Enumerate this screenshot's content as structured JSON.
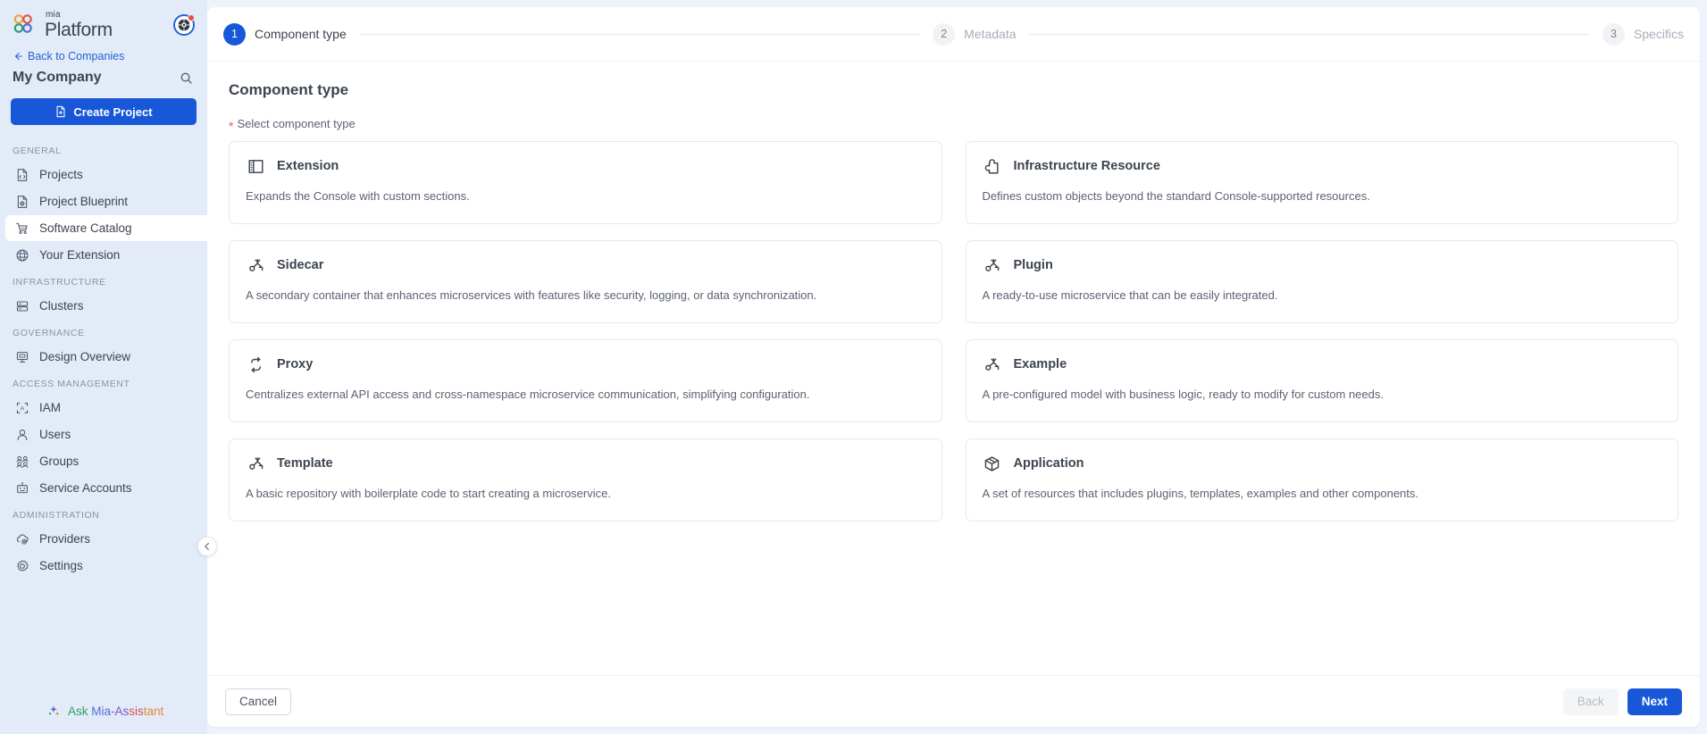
{
  "sidebar": {
    "brand": {
      "small": "mia",
      "name": "Platform",
      "logo_icon": "mia-logo-icon"
    },
    "avatar": {
      "icon": "user-avatar-icon",
      "notification_dot": true
    },
    "back_link": {
      "label": "Back to Companies",
      "icon": "arrow-left-icon"
    },
    "company": {
      "name": "My Company",
      "search_icon": "search-icon"
    },
    "create_button": {
      "label": "Create Project",
      "icon": "file-plus-icon"
    },
    "sections": [
      {
        "title": "GENERAL",
        "items": [
          {
            "label": "Projects",
            "icon": "projects-file-icon",
            "active": false
          },
          {
            "label": "Project Blueprint",
            "icon": "blueprint-icon",
            "active": false
          },
          {
            "label": "Software Catalog",
            "icon": "catalog-cart-icon",
            "active": true
          },
          {
            "label": "Your Extension",
            "icon": "globe-icon",
            "active": false
          }
        ]
      },
      {
        "title": "INFRASTRUCTURE",
        "items": [
          {
            "label": "Clusters",
            "icon": "clusters-icon",
            "active": false
          }
        ]
      },
      {
        "title": "GOVERNANCE",
        "items": [
          {
            "label": "Design Overview",
            "icon": "design-board-icon",
            "active": false
          }
        ]
      },
      {
        "title": "ACCESS MANAGEMENT",
        "items": [
          {
            "label": "IAM",
            "icon": "iam-scan-icon",
            "active": false
          },
          {
            "label": "Users",
            "icon": "user-icon",
            "active": false
          },
          {
            "label": "Groups",
            "icon": "groups-icon",
            "active": false
          },
          {
            "label": "Service Accounts",
            "icon": "robot-icon",
            "active": false
          }
        ]
      },
      {
        "title": "ADMINISTRATION",
        "items": [
          {
            "label": "Providers",
            "icon": "cloud-gear-icon",
            "active": false
          },
          {
            "label": "Settings",
            "icon": "gear-icon",
            "active": false
          }
        ]
      }
    ],
    "assistant": {
      "icon": "sparkle-icon",
      "parts": [
        "Ask",
        " Mia",
        "-As",
        "sis",
        "tant"
      ]
    },
    "collapse_button": {
      "icon": "chevron-left-icon"
    }
  },
  "stepper": {
    "steps": [
      {
        "num": "1",
        "label": "Component type",
        "state": "active"
      },
      {
        "num": "2",
        "label": "Metadata",
        "state": "inactive"
      },
      {
        "num": "3",
        "label": "Specifics",
        "state": "inactive"
      }
    ]
  },
  "main": {
    "title": "Component type",
    "field_label": "Select component type",
    "required_marker": "*",
    "cards": [
      {
        "title": "Extension",
        "desc": "Expands the Console with custom sections.",
        "icon": "extension-panel-icon"
      },
      {
        "title": "Infrastructure Resource",
        "desc": "Defines custom objects beyond the standard Console-supported resources.",
        "icon": "puzzle-piece-icon"
      },
      {
        "title": "Sidecar",
        "desc": "A secondary container that enhances microservices with features like security, logging, or data synchronization.",
        "icon": "node-hierarchy-icon"
      },
      {
        "title": "Plugin",
        "desc": "A ready-to-use microservice that can be easily integrated.",
        "icon": "node-hierarchy-icon"
      },
      {
        "title": "Proxy",
        "desc": "Centralizes external API access and cross-namespace microservice communication, simplifying configuration.",
        "icon": "swap-arrows-icon"
      },
      {
        "title": "Example",
        "desc": "A pre-configured model with business logic, ready to modify for custom needs.",
        "icon": "node-hierarchy-icon"
      },
      {
        "title": "Template",
        "desc": "A basic repository with boilerplate code to start creating a microservice.",
        "icon": "node-hierarchy-icon"
      },
      {
        "title": "Application",
        "desc": "A set of resources that includes plugins, templates, examples and other components.",
        "icon": "package-box-icon"
      }
    ]
  },
  "footer": {
    "cancel_label": "Cancel",
    "back_label": "Back",
    "next_label": "Next"
  },
  "colors": {
    "accent": "#1858d8",
    "sidebar_bg": "#e3ebf9",
    "required": "#e8564b",
    "notification": "#f4493d"
  }
}
